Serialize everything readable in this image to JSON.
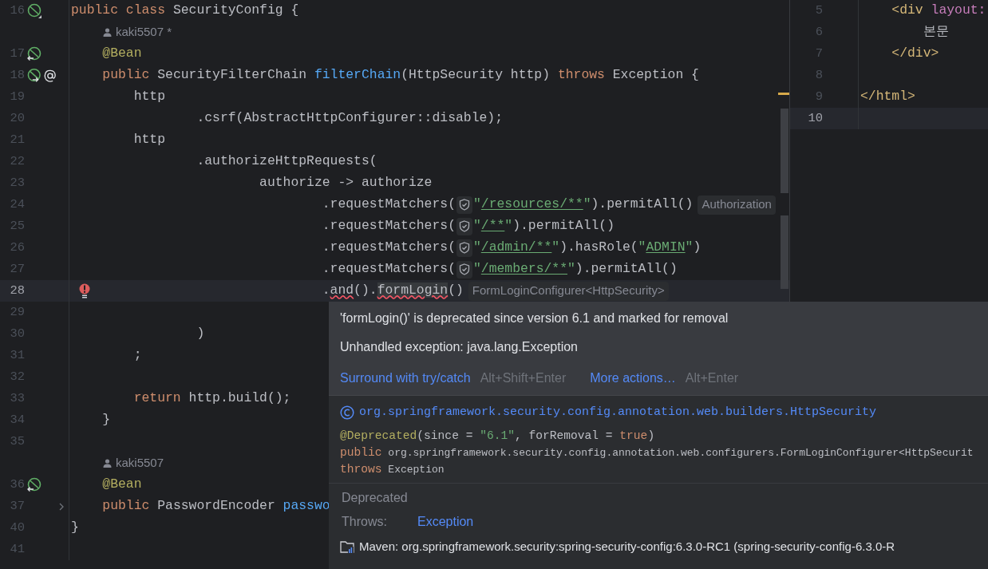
{
  "left_editor": {
    "lines": [
      {
        "kind": "code",
        "number": "16",
        "current": false,
        "gutter_icons": [
          {
            "kind": "bean"
          }
        ],
        "tokens": [
          {
            "kind": "keyword",
            "text": "public class"
          },
          {
            "kind": "plain",
            "text": " SecurityConfig {"
          }
        ]
      },
      {
        "kind": "author",
        "author": "kaki5507 *"
      },
      {
        "kind": "code",
        "number": "17",
        "current": false,
        "gutter_icons": [
          {
            "kind": "bean-in"
          }
        ],
        "tokens": [
          {
            "kind": "annotation",
            "text": "    @Bean"
          }
        ]
      },
      {
        "kind": "code",
        "number": "18",
        "current": false,
        "gutter_icons": [
          {
            "kind": "bean-out"
          },
          {
            "kind": "at"
          }
        ],
        "tokens": [
          {
            "kind": "keyword",
            "text": "    public"
          },
          {
            "kind": "plain",
            "text": " SecurityFilterChain "
          },
          {
            "kind": "method",
            "text": "filterChain"
          },
          {
            "kind": "plain",
            "text": "(HttpSecurity http) "
          },
          {
            "kind": "keyword",
            "text": "throws"
          },
          {
            "kind": "plain",
            "text": " Exception {"
          }
        ]
      },
      {
        "kind": "code",
        "number": "19",
        "current": false,
        "tokens": [
          {
            "kind": "plain",
            "text": "        http"
          }
        ]
      },
      {
        "kind": "code",
        "number": "20",
        "current": false,
        "tokens": [
          {
            "kind": "plain",
            "text": "                .csrf(AbstractHttpConfigurer::disable);"
          }
        ]
      },
      {
        "kind": "code",
        "number": "21",
        "current": false,
        "tokens": [
          {
            "kind": "plain",
            "text": "        http"
          }
        ]
      },
      {
        "kind": "code",
        "number": "22",
        "current": false,
        "tokens": [
          {
            "kind": "plain",
            "text": "                .authorizeHttpRequests("
          }
        ]
      },
      {
        "kind": "code",
        "number": "23",
        "current": false,
        "tokens": [
          {
            "kind": "plain",
            "text": "                        authorize -> authorize"
          }
        ]
      },
      {
        "kind": "code",
        "number": "24",
        "current": false,
        "tokens": [
          {
            "kind": "plain",
            "text": "                                .requestMatchers("
          },
          {
            "kind": "shield"
          },
          {
            "kind": "string",
            "text": "\""
          },
          {
            "kind": "link-string",
            "text": "/resources/**"
          },
          {
            "kind": "string",
            "text": "\""
          },
          {
            "kind": "plain",
            "text": ").permitAll()"
          },
          {
            "kind": "hint",
            "text": "Authorization"
          }
        ]
      },
      {
        "kind": "code",
        "number": "25",
        "current": false,
        "tokens": [
          {
            "kind": "plain",
            "text": "                                .requestMatchers("
          },
          {
            "kind": "shield"
          },
          {
            "kind": "string",
            "text": "\""
          },
          {
            "kind": "link-string",
            "text": "/**"
          },
          {
            "kind": "string",
            "text": "\""
          },
          {
            "kind": "plain",
            "text": ").permitAll()"
          }
        ]
      },
      {
        "kind": "code",
        "number": "26",
        "current": false,
        "tokens": [
          {
            "kind": "plain",
            "text": "                                .requestMatchers("
          },
          {
            "kind": "shield"
          },
          {
            "kind": "string",
            "text": "\""
          },
          {
            "kind": "link-string",
            "text": "/admin/**"
          },
          {
            "kind": "string",
            "text": "\""
          },
          {
            "kind": "plain",
            "text": ").hasRole("
          },
          {
            "kind": "string",
            "text": "\""
          },
          {
            "kind": "link-string",
            "text": "ADMIN"
          },
          {
            "kind": "string",
            "text": "\""
          },
          {
            "kind": "plain",
            "text": ")"
          }
        ]
      },
      {
        "kind": "code",
        "number": "27",
        "current": false,
        "tokens": [
          {
            "kind": "plain",
            "text": "                                .requestMatchers("
          },
          {
            "kind": "shield"
          },
          {
            "kind": "string",
            "text": "\""
          },
          {
            "kind": "link-string",
            "text": "/members/**"
          },
          {
            "kind": "string",
            "text": "\""
          },
          {
            "kind": "plain",
            "text": ").permitAll()"
          }
        ]
      },
      {
        "kind": "code",
        "number": "28",
        "current": true,
        "gutter_icons": [
          {
            "kind": "error-bulb"
          }
        ],
        "tokens": [
          {
            "kind": "plain",
            "text": "                                ."
          },
          {
            "kind": "error",
            "text": "and"
          },
          {
            "kind": "plain",
            "text": "()."
          },
          {
            "kind": "error-focus",
            "text": "formLogin"
          },
          {
            "kind": "plain",
            "text": "()"
          },
          {
            "kind": "hint",
            "text": "FormLoginConfigurer<HttpSecurity>"
          }
        ]
      },
      {
        "kind": "code",
        "number": "29",
        "current": false
      },
      {
        "kind": "code",
        "number": "30",
        "current": false,
        "tokens": [
          {
            "kind": "plain",
            "text": "                )"
          }
        ]
      },
      {
        "kind": "code",
        "number": "31",
        "current": false,
        "tokens": [
          {
            "kind": "plain",
            "text": "        ;"
          }
        ]
      },
      {
        "kind": "code",
        "number": "32",
        "current": false
      },
      {
        "kind": "code",
        "number": "33",
        "current": false,
        "tokens": [
          {
            "kind": "keyword",
            "text": "        return"
          },
          {
            "kind": "plain",
            "text": " http.build();"
          }
        ]
      },
      {
        "kind": "code",
        "number": "34",
        "current": false,
        "tokens": [
          {
            "kind": "plain",
            "text": "    }"
          }
        ]
      },
      {
        "kind": "code",
        "number": "35",
        "current": false
      },
      {
        "kind": "author",
        "author": "kaki5507"
      },
      {
        "kind": "code",
        "number": "36",
        "current": false,
        "gutter_icons": [
          {
            "kind": "bean-in"
          }
        ],
        "tokens": [
          {
            "kind": "annotation",
            "text": "    @Bean"
          }
        ]
      },
      {
        "kind": "code",
        "number": "37",
        "current": false,
        "gutter_icons": [
          {
            "kind": "fold"
          }
        ],
        "tokens": [
          {
            "kind": "keyword",
            "text": "    public"
          },
          {
            "kind": "plain",
            "text": " PasswordEncoder "
          },
          {
            "kind": "method",
            "text": "passwo"
          }
        ]
      },
      {
        "kind": "code",
        "number": "40",
        "current": false,
        "tokens": [
          {
            "kind": "plain",
            "text": "}"
          }
        ]
      },
      {
        "kind": "code",
        "number": "41",
        "current": false
      }
    ]
  },
  "right_editor": {
    "lines": [
      {
        "number": "5",
        "current": false,
        "tokens": [
          {
            "kind": "tag",
            "text": "    <div"
          },
          {
            "kind": "attr",
            "text": " layout:"
          }
        ]
      },
      {
        "number": "6",
        "current": false,
        "tokens": [
          {
            "kind": "plain",
            "text": "        본문"
          }
        ]
      },
      {
        "number": "7",
        "current": false,
        "tokens": [
          {
            "kind": "tag",
            "text": "    </div>"
          }
        ]
      },
      {
        "number": "8",
        "current": false
      },
      {
        "number": "9",
        "current": false,
        "tokens": [
          {
            "kind": "tag",
            "text": "</html>"
          }
        ]
      },
      {
        "number": "10",
        "current": true
      }
    ]
  },
  "popup": {
    "messages": [
      "'formLogin()' is deprecated since version 6.1 and marked for removal",
      "Unhandled exception: java.lang.Exception"
    ],
    "actions": [
      {
        "label": "Surround with try/catch",
        "shortcut": "Alt+Shift+Enter"
      },
      {
        "label": "More actions…",
        "shortcut": "Alt+Enter"
      }
    ],
    "class_name": "org.springframework.security.config.annotation.web.builders.HttpSecurity",
    "signature": [
      [
        {
          "kind": "annotation",
          "text": "@Deprecated"
        },
        {
          "kind": "plain",
          "text": "(since = "
        },
        {
          "kind": "string",
          "text": "\"6.1\""
        },
        {
          "kind": "plain",
          "text": ", forRemoval = "
        },
        {
          "kind": "keyword",
          "text": "true"
        },
        {
          "kind": "plain",
          "text": ")"
        }
      ],
      [
        {
          "kind": "keyword",
          "text": "public"
        },
        {
          "kind": "small",
          "text": " org.springframework.security.config.annotation.web.configurers.FormLoginConfigurer<HttpSecurit"
        }
      ],
      [
        {
          "kind": "keyword",
          "text": "throws"
        },
        {
          "kind": "small",
          "text": " Exception"
        }
      ]
    ],
    "deprecated_label": "Deprecated",
    "throws_label": "Throws:",
    "throws_value": "Exception",
    "source": "Maven: org.springframework.security:spring-security-config:6.3.0-RC1 (spring-security-config-6.3.0-R"
  }
}
